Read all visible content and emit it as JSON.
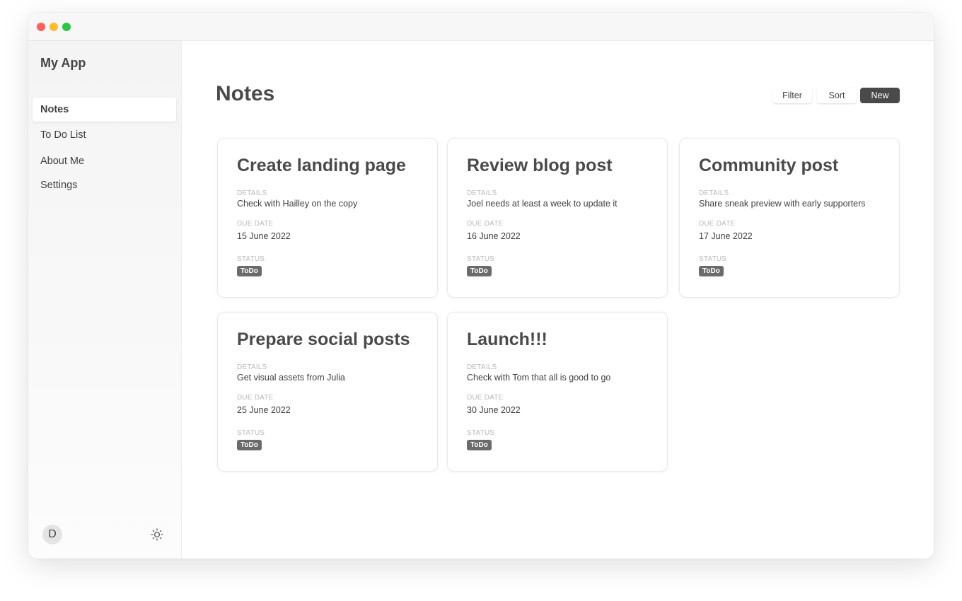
{
  "app": {
    "title": "My App",
    "avatar_initial": "D"
  },
  "sidebar": {
    "items": [
      {
        "label": "Notes",
        "active": true
      },
      {
        "label": "To Do List",
        "active": false
      },
      {
        "label": "About Me",
        "active": false
      },
      {
        "label": "Settings",
        "active": false
      }
    ]
  },
  "header": {
    "title": "Notes",
    "filter_label": "Filter",
    "sort_label": "Sort",
    "new_label": "New"
  },
  "labels": {
    "details": "DETAILS",
    "due_date": "DUE DATE",
    "status": "STATUS"
  },
  "notes": [
    {
      "title": "Create landing page",
      "details": "Check with Hailley on the copy",
      "due_date": "15 June 2022",
      "status": "ToDo"
    },
    {
      "title": "Review blog post",
      "details": "Joel needs at least a week to update it",
      "due_date": "16 June 2022",
      "status": "ToDo"
    },
    {
      "title": "Community post",
      "details": "Share sneak preview with early supporters",
      "due_date": "17 June 2022",
      "status": "ToDo"
    },
    {
      "title": "Prepare social posts",
      "details": "Get visual assets from Julia",
      "due_date": "25 June 2022",
      "status": "ToDo"
    },
    {
      "title": "Launch!!!",
      "details": "Check with Tom that all is good to go",
      "due_date": "30 June 2022",
      "status": "ToDo"
    }
  ],
  "icons": {
    "theme_toggle": "sun-icon"
  },
  "colors": {
    "accent_dark": "#4a4a4a",
    "status_badge": "#6b6b6b",
    "traffic_red": "#ff5f57",
    "traffic_yellow": "#febc2e",
    "traffic_green": "#28c840"
  }
}
